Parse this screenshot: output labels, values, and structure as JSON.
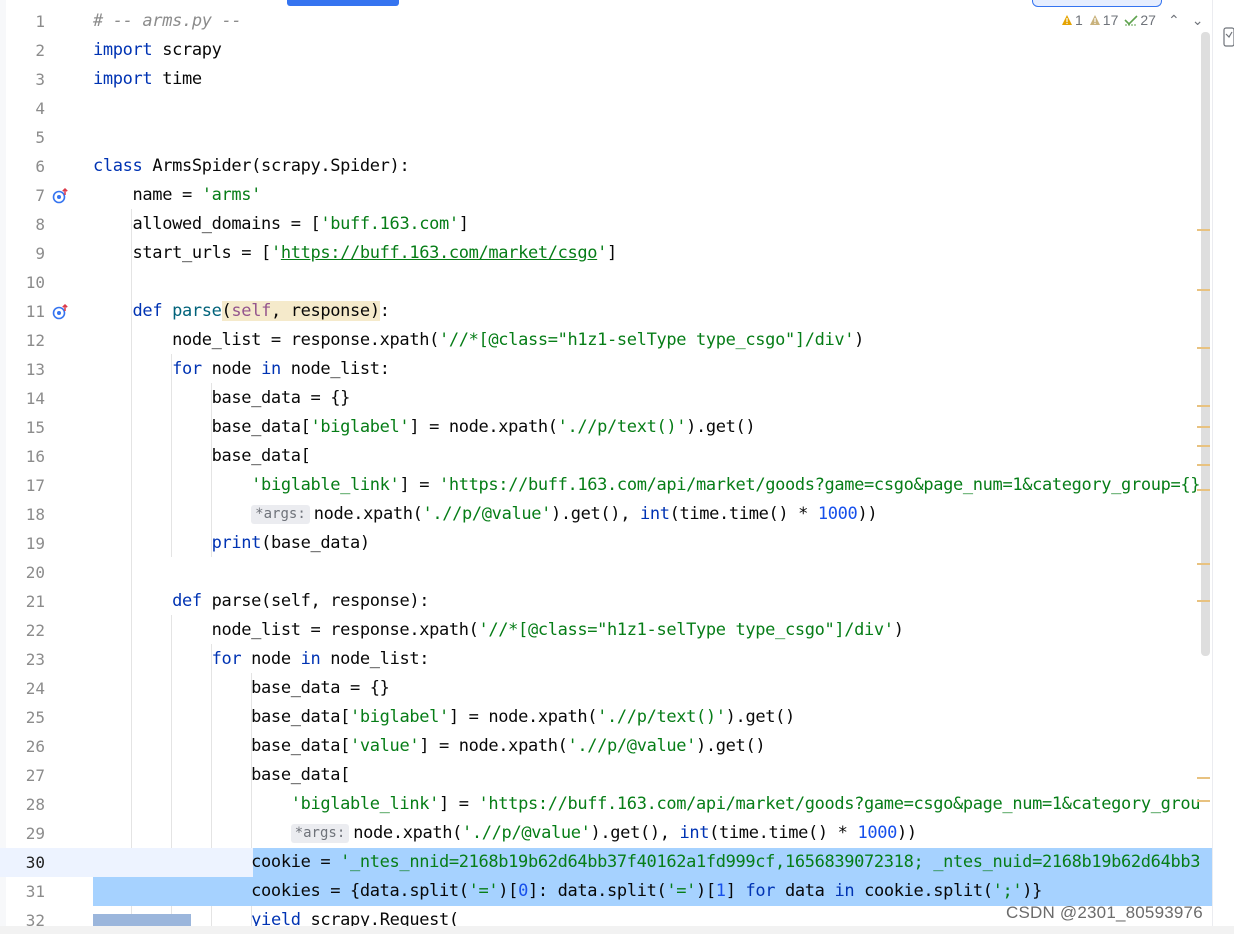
{
  "file_header": "# -- arms.py --",
  "inspections": {
    "errors": "1",
    "warnings": "17",
    "weak_warnings": "27"
  },
  "colors": {
    "keyword": "#0033b3",
    "string": "#067d17",
    "number": "#1750eb",
    "comment": "#8c8c8c",
    "selection": "#a6d2ff",
    "current_line": "#edf3ff"
  },
  "lines": [
    {
      "n": "1",
      "text": "# -- arms.py --"
    },
    {
      "n": "2",
      "text": "import scrapy"
    },
    {
      "n": "3",
      "text": "import time"
    },
    {
      "n": "4",
      "text": ""
    },
    {
      "n": "5",
      "text": ""
    },
    {
      "n": "6",
      "text": "class ArmsSpider(scrapy.Spider):"
    },
    {
      "n": "7",
      "text": "name = 'arms'",
      "gutter_icon": "override-icon"
    },
    {
      "n": "8",
      "text": "allowed_domains = ['buff.163.com']"
    },
    {
      "n": "9",
      "text": "start_urls = ['https://buff.163.com/market/csgo']"
    },
    {
      "n": "10",
      "text": ""
    },
    {
      "n": "11",
      "text": "def parse(self, response):",
      "gutter_icon": "override-icon"
    },
    {
      "n": "12",
      "text": "node_list = response.xpath('//*[@class=\"h1z1-selType type_csgo\"]/div')"
    },
    {
      "n": "13",
      "text": "for node in node_list:"
    },
    {
      "n": "14",
      "text": "base_data = {}"
    },
    {
      "n": "15",
      "text": "base_data['biglabel'] = node.xpath('.//p/text()').get()"
    },
    {
      "n": "16",
      "text": "base_data["
    },
    {
      "n": "17",
      "text": "'biglable_link'] = 'https://buff.163.com/api/market/goods?game=csgo&page_num=1&category_group={}"
    },
    {
      "n": "18",
      "hint": "*args:",
      "text": "node.xpath('.//p/@value').get(), int(time.time() * 1000))"
    },
    {
      "n": "19",
      "text": "print(base_data)"
    },
    {
      "n": "20",
      "text": ""
    },
    {
      "n": "21",
      "text": "def parse(self, response):"
    },
    {
      "n": "22",
      "text": "node_list = response.xpath('//*[@class=\"h1z1-selType type_csgo\"]/div')"
    },
    {
      "n": "23",
      "text": "for node in node_list:"
    },
    {
      "n": "24",
      "text": "base_data = {}"
    },
    {
      "n": "25",
      "text": "base_data['biglabel'] = node.xpath('.//p/text()').get()"
    },
    {
      "n": "26",
      "text": "base_data['value'] = node.xpath('.//p/@value').get()"
    },
    {
      "n": "27",
      "text": "base_data["
    },
    {
      "n": "28",
      "text": "'biglable_link'] = 'https://buff.163.com/api/market/goods?game=csgo&page_num=1&category_grou"
    },
    {
      "n": "29",
      "hint": "*args:",
      "text": "node.xpath('.//p/@value').get(), int(time.time() * 1000))"
    },
    {
      "n": "30",
      "text": "cookie = '_ntes_nnid=2168b19b62d64bb37f40162a1fd999cf,1656839072318; _ntes_nuid=2168b19b62d64bb3"
    },
    {
      "n": "31",
      "text": "cookies = {data.split('=')[0]: data.split('=')[1] for data in cookie.split(';')}"
    },
    {
      "n": "32",
      "text": "yield scrapy.Request("
    }
  ],
  "watermark": "CSDN @2301_80593976"
}
